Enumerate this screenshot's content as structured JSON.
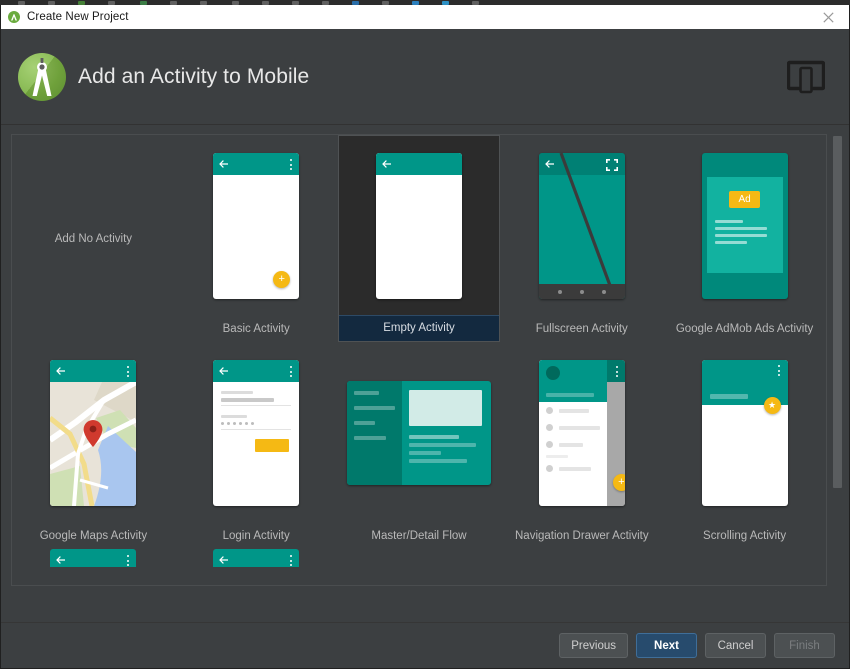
{
  "window": {
    "title": "Create New Project",
    "close_label": "×",
    "app_icon": "android-studio-icon"
  },
  "header": {
    "title": "Add an Activity to Mobile",
    "logo_icon": "android-studio-logo",
    "form_factor_icon": "mobile-device-icon"
  },
  "gallery": {
    "items": [
      {
        "label": "Add No Activity",
        "thumb": "none",
        "selected": false
      },
      {
        "label": "Basic Activity",
        "thumb": "basic",
        "selected": false
      },
      {
        "label": "Empty Activity",
        "thumb": "empty",
        "selected": true
      },
      {
        "label": "Fullscreen Activity",
        "thumb": "fullscreen",
        "selected": false
      },
      {
        "label": "Google AdMob Ads Activity",
        "thumb": "admob",
        "selected": false
      },
      {
        "label": "Google Maps Activity",
        "thumb": "maps",
        "selected": false
      },
      {
        "label": "Login Activity",
        "thumb": "login",
        "selected": false
      },
      {
        "label": "Master/Detail Flow",
        "thumb": "masterdetail",
        "selected": false
      },
      {
        "label": "Navigation Drawer Activity",
        "thumb": "drawer",
        "selected": false
      },
      {
        "label": "Scrolling Activity",
        "thumb": "scrolling",
        "selected": false
      }
    ],
    "ad_badge_text": "Ad",
    "fab_plus": "+",
    "fab_star": "★"
  },
  "footer": {
    "previous_label": "Previous",
    "next_label": "Next",
    "cancel_label": "Cancel",
    "finish_label": "Finish"
  },
  "colors": {
    "accent_teal": "#009688",
    "accent_yellow": "#f5b914",
    "selection_blue": "#13293f",
    "default_button_blue": "#274b6d",
    "window_bg": "#3c3f41",
    "logo_green": "#7cb342"
  }
}
